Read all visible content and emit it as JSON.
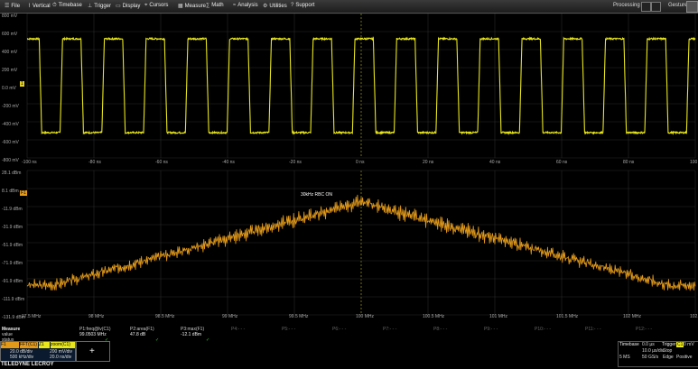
{
  "colors": {
    "trace_c1": "#e8e61c",
    "trace_fft": "#e39a1a",
    "grid": "#2a2a2a",
    "center": "#8a8a20",
    "check": "#32d232"
  },
  "menu": [
    {
      "icon": "file-icon",
      "label": "File"
    },
    {
      "icon": "vertical-icon",
      "label": "Vertical"
    },
    {
      "icon": "timebase-icon",
      "label": "Timebase"
    },
    {
      "icon": "trigger-icon",
      "label": "Trigger"
    },
    {
      "icon": "display-icon",
      "label": "Display"
    },
    {
      "icon": "cursors-icon",
      "label": "Cursors"
    },
    {
      "icon": "measure-icon",
      "label": "Measure"
    },
    {
      "icon": "math-icon",
      "label": "Math"
    },
    {
      "icon": "analysis-icon",
      "label": "Analysis"
    },
    {
      "icon": "utilities-icon",
      "label": "Utilities"
    },
    {
      "icon": "support-icon",
      "label": "Support"
    }
  ],
  "status": {
    "processing": "Processing",
    "gesture": "Gesture"
  },
  "top": {
    "ytick_labels": [
      "800 mV",
      "600 mV",
      "400 mV",
      "200 mV",
      "0.0 mV",
      "-200 mV",
      "-400 mV",
      "-600 mV",
      "-800 mV"
    ],
    "xtick_labels": [
      "-100 ns",
      "-80 ns",
      "-60 ns",
      "-40 ns",
      "-20 ns",
      "0 ns",
      "20 ns",
      "40 ns",
      "60 ns",
      "80 ns",
      "100 ns"
    ],
    "marker": "1"
  },
  "bottom": {
    "ytick_labels": [
      "28.1 dBm",
      "8.1 dBm",
      "-11.9 dBm",
      "-31.9 dBm",
      "-51.9 dBm",
      "-71.9 dBm",
      "-91.9 dBm",
      "-111.9 dBm",
      "-131.9 dBm"
    ],
    "xtick_labels": [
      "97.5 MHz",
      "98 MHz",
      "98.5 MHz",
      "99 MHz",
      "99.5 MHz",
      "100 MHz",
      "100.5 MHz",
      "101 MHz",
      "101.5 MHz",
      "102 MHz",
      "102.5 MHz"
    ],
    "marker": "F1",
    "annotation": "30kHz RBC ON"
  },
  "chart_data": [
    {
      "type": "line",
      "x_unit": "ns",
      "y_unit": "mV",
      "xlim": [
        -100,
        100
      ],
      "ylim": [
        -800,
        800
      ],
      "cycles_visible": 16,
      "high": 520,
      "low": -520,
      "grid": true
    },
    {
      "type": "line",
      "x_unit": "MHz",
      "y_unit": "dBm",
      "xlim": [
        97.5,
        102.5
      ],
      "ylim": [
        -131.9,
        28.1
      ],
      "center_freq": 100,
      "peak": -7,
      "floor": -99,
      "grid": true
    }
  ],
  "measure": {
    "row_labels": [
      "Measure",
      "value",
      "status"
    ],
    "params": [
      {
        "name": "P1:freq@lv(C1)",
        "value": "99.0503 MHz",
        "status": "✓"
      },
      {
        "name": "P2:area(F1)",
        "value": "47.8 dB",
        "status": "✓"
      },
      {
        "name": "P3:max(F1)",
        "value": "-12.1 dBm",
        "status": "✓"
      },
      {
        "name": "P4:- - -",
        "value": "",
        "status": ""
      },
      {
        "name": "P5:- - -",
        "value": "",
        "status": ""
      },
      {
        "name": "P6:- - -",
        "value": "",
        "status": ""
      },
      {
        "name": "P7:- - -",
        "value": "",
        "status": ""
      },
      {
        "name": "P8:- - -",
        "value": "",
        "status": ""
      },
      {
        "name": "P9:- - -",
        "value": "",
        "status": ""
      },
      {
        "name": "P10:- - -",
        "value": "",
        "status": ""
      },
      {
        "name": "P11:- - -",
        "value": "",
        "status": ""
      },
      {
        "name": "P12:- - -",
        "value": "",
        "status": ""
      }
    ]
  },
  "channels": {
    "c1": {
      "name": "C1",
      "line1": "",
      "line2": ""
    },
    "f1": {
      "name": "F1",
      "fn": "FFT(C1)",
      "line1": "20.0 dB/div",
      "line2": "500 kHz/div"
    },
    "z1": {
      "name": "Z1",
      "fn": "zoom(C1)",
      "line1": "200 mV/div",
      "line2": "20.0 ns/div"
    },
    "add": "+"
  },
  "timebase": {
    "label": "Timebase",
    "offset": "0.0 µs",
    "tdiv": "10.0 µs/div",
    "samples": "5 MS",
    "rate": "50 GS/s"
  },
  "trigger": {
    "label": "Trigger",
    "src": "C1",
    "mode": "Stop",
    "type": "Edge",
    "level": "0 mV",
    "slope": "Positive"
  },
  "brand": "TELEDYNE LECROY"
}
